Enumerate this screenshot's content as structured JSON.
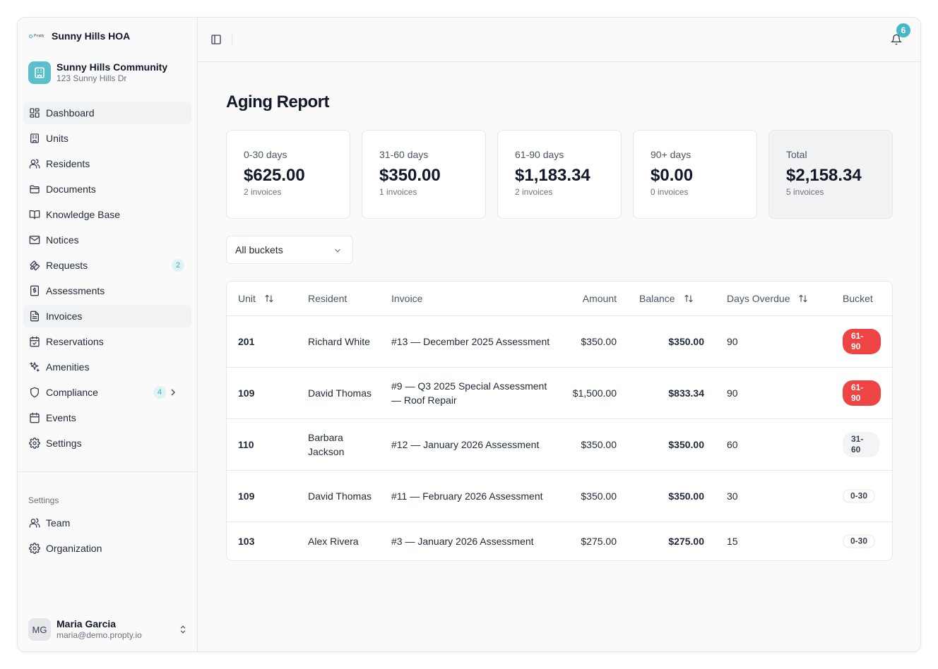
{
  "brand": {
    "logo_text": "Propty",
    "name": "Sunny Hills HOA"
  },
  "community": {
    "name": "Sunny Hills Community",
    "address": "123 Sunny Hills Dr"
  },
  "nav": [
    {
      "label": "Dashboard",
      "icon": "dashboard-icon",
      "active": true
    },
    {
      "label": "Units",
      "icon": "building-icon"
    },
    {
      "label": "Residents",
      "icon": "users-icon"
    },
    {
      "label": "Documents",
      "icon": "folder-icon"
    },
    {
      "label": "Knowledge Base",
      "icon": "book-icon"
    },
    {
      "label": "Notices",
      "icon": "mail-icon"
    },
    {
      "label": "Requests",
      "icon": "wrench-icon",
      "badge": "2"
    },
    {
      "label": "Assessments",
      "icon": "dollar-receipt-icon"
    },
    {
      "label": "Invoices",
      "icon": "file-text-icon",
      "active": true
    },
    {
      "label": "Reservations",
      "icon": "calendar-check-icon"
    },
    {
      "label": "Amenities",
      "icon": "sparkles-icon"
    },
    {
      "label": "Compliance",
      "icon": "shield-icon",
      "badge": "4",
      "chevron": true
    },
    {
      "label": "Events",
      "icon": "calendar-icon"
    },
    {
      "label": "Settings",
      "icon": "gear-icon"
    }
  ],
  "settings_section": {
    "label": "Settings",
    "items": [
      {
        "label": "Team",
        "icon": "users-icon"
      },
      {
        "label": "Organization",
        "icon": "gear-icon"
      }
    ]
  },
  "user": {
    "initials": "MG",
    "name": "Maria Garcia",
    "email": "maria@demo.propty.io"
  },
  "topbar": {
    "notification_count": "6"
  },
  "page": {
    "title": "Aging Report"
  },
  "cards": [
    {
      "label": "0-30 days",
      "value": "$625.00",
      "count": "2 invoices"
    },
    {
      "label": "31-60 days",
      "value": "$350.00",
      "count": "1 invoices"
    },
    {
      "label": "61-90 days",
      "value": "$1,183.34",
      "count": "2 invoices"
    },
    {
      "label": "90+ days",
      "value": "$0.00",
      "count": "0 invoices"
    },
    {
      "label": "Total",
      "value": "$2,158.34",
      "count": "5 invoices"
    }
  ],
  "filter": {
    "selected": "All buckets"
  },
  "table": {
    "headers": {
      "unit": "Unit",
      "resident": "Resident",
      "invoice": "Invoice",
      "amount": "Amount",
      "balance": "Balance",
      "days": "Days Overdue",
      "bucket": "Bucket"
    },
    "rows": [
      {
        "unit": "201",
        "resident": "Richard White",
        "invoice": "#13 — December 2025 Assessment",
        "amount": "$350.00",
        "balance": "$350.00",
        "days": "90",
        "bucket": "61-90",
        "style": "red"
      },
      {
        "unit": "109",
        "resident": "David Thomas",
        "invoice": "#9 — Q3 2025 Special Assessment — Roof Repair",
        "amount": "$1,500.00",
        "balance": "$833.34",
        "days": "90",
        "bucket": "61-90",
        "style": "red"
      },
      {
        "unit": "110",
        "resident": "Barbara Jackson",
        "invoice": "#12 — January 2026 Assessment",
        "amount": "$350.00",
        "balance": "$350.00",
        "days": "60",
        "bucket": "31-60",
        "style": "grey"
      },
      {
        "unit": "109",
        "resident": "David Thomas",
        "invoice": "#11 — February 2026 Assessment",
        "amount": "$350.00",
        "balance": "$350.00",
        "days": "30",
        "bucket": "0-30",
        "style": "outline"
      },
      {
        "unit": "103",
        "resident": "Alex Rivera",
        "invoice": "#3 — January 2026 Assessment",
        "amount": "$275.00",
        "balance": "$275.00",
        "days": "15",
        "bucket": "0-30",
        "style": "outline"
      }
    ]
  },
  "colors": {
    "accent": "#46b8c8",
    "danger": "#ef4444"
  }
}
